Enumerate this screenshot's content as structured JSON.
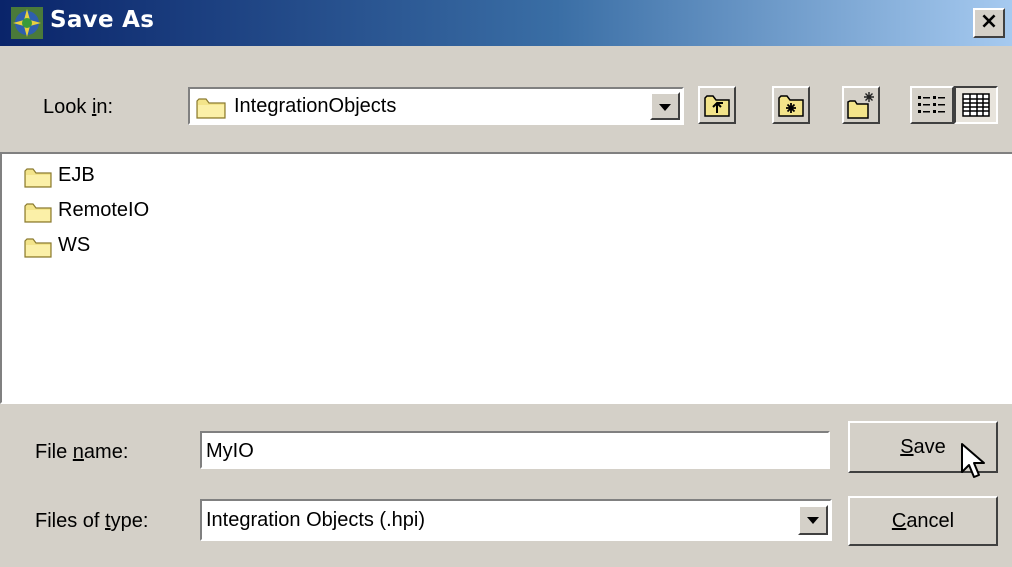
{
  "window": {
    "title": "Save As",
    "close_glyph": "×",
    "title_icon": "java-cup-icon"
  },
  "look_in": {
    "label_pre": "Look ",
    "label_mnemonic": "i",
    "label_post": "n:",
    "value": "IntegrationObjects"
  },
  "toolbar": {
    "buttons": [
      {
        "name": "up-one-level",
        "icon": "folder-up-icon"
      },
      {
        "name": "home",
        "icon": "home-folder-icon"
      },
      {
        "name": "new-folder",
        "icon": "new-folder-icon"
      },
      {
        "name": "list-view",
        "icon": "list-view-icon"
      },
      {
        "name": "details-view",
        "icon": "details-view-icon"
      }
    ]
  },
  "files": [
    {
      "name": "EJB",
      "icon": "folder-icon"
    },
    {
      "name": "RemoteIO",
      "icon": "folder-icon"
    },
    {
      "name": "WS",
      "icon": "folder-icon"
    }
  ],
  "file_name": {
    "label_pre": "File ",
    "label_mnemonic": "n",
    "label_post": "ame:",
    "value": "MyIO"
  },
  "file_type": {
    "label_pre": "Files of ",
    "label_mnemonic": "t",
    "label_post": "ype:",
    "value": "Integration Objects (.hpi)"
  },
  "buttons": {
    "save_mnemonic": "S",
    "save_rest": "ave",
    "cancel_mnemonic": "C",
    "cancel_rest": "ancel"
  },
  "colors": {
    "title_gradient_start": "#0a246a",
    "title_gradient_end": "#a6caf0",
    "folder_yellow": "#f3e48a",
    "face": "#d4d0c8"
  }
}
